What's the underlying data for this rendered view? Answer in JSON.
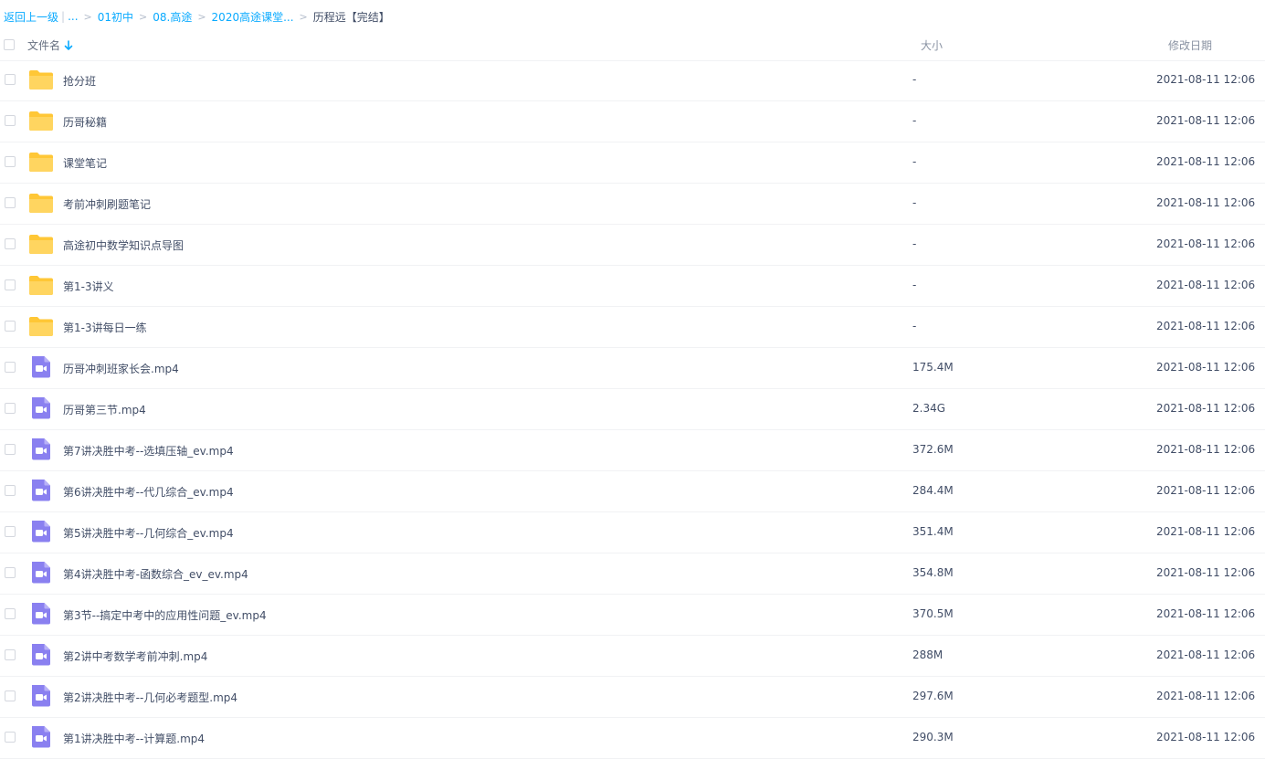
{
  "breadcrumb": {
    "back": "返回上一级",
    "separator": "|",
    "ellipsis": "...",
    "arrow": ">",
    "crumbs": [
      "01初中",
      "08.高途",
      "2020高途课堂..."
    ],
    "current": "历程远【完结】"
  },
  "header": {
    "name": "文件名",
    "size": "大小",
    "date": "修改日期",
    "sort_icon": "arrow-down-icon"
  },
  "colors": {
    "link": "#09aaff",
    "folder": "#ffd04b",
    "video": "#8a80f0",
    "text": "#424e67"
  },
  "files": [
    {
      "type": "folder",
      "name": "抢分班",
      "size": "-",
      "date": "2021-08-11 12:06"
    },
    {
      "type": "folder",
      "name": "历哥秘籍",
      "size": "-",
      "date": "2021-08-11 12:06"
    },
    {
      "type": "folder",
      "name": "课堂笔记",
      "size": "-",
      "date": "2021-08-11 12:06"
    },
    {
      "type": "folder",
      "name": "考前冲刺刷题笔记",
      "size": "-",
      "date": "2021-08-11 12:06"
    },
    {
      "type": "folder",
      "name": "高途初中数学知识点导图",
      "size": "-",
      "date": "2021-08-11 12:06"
    },
    {
      "type": "folder",
      "name": "第1-3讲义",
      "size": "-",
      "date": "2021-08-11 12:06"
    },
    {
      "type": "folder",
      "name": "第1-3讲每日一练",
      "size": "-",
      "date": "2021-08-11 12:06"
    },
    {
      "type": "video",
      "name": "历哥冲刺班家长会.mp4",
      "size": "175.4M",
      "date": "2021-08-11 12:06"
    },
    {
      "type": "video",
      "name": "历哥第三节.mp4",
      "size": "2.34G",
      "date": "2021-08-11 12:06"
    },
    {
      "type": "video",
      "name": "第7讲决胜中考--选填压轴_ev.mp4",
      "size": "372.6M",
      "date": "2021-08-11 12:06"
    },
    {
      "type": "video",
      "name": "第6讲决胜中考--代几综合_ev.mp4",
      "size": "284.4M",
      "date": "2021-08-11 12:06"
    },
    {
      "type": "video",
      "name": "第5讲决胜中考--几何综合_ev.mp4",
      "size": "351.4M",
      "date": "2021-08-11 12:06"
    },
    {
      "type": "video",
      "name": "第4讲决胜中考-函数综合_ev_ev.mp4",
      "size": "354.8M",
      "date": "2021-08-11 12:06"
    },
    {
      "type": "video",
      "name": "第3节--搞定中考中的应用性问题_ev.mp4",
      "size": "370.5M",
      "date": "2021-08-11 12:06"
    },
    {
      "type": "video",
      "name": "第2讲中考数学考前冲刺.mp4",
      "size": "288M",
      "date": "2021-08-11 12:06"
    },
    {
      "type": "video",
      "name": "第2讲决胜中考--几何必考题型.mp4",
      "size": "297.6M",
      "date": "2021-08-11 12:06"
    },
    {
      "type": "video",
      "name": "第1讲决胜中考--计算题.mp4",
      "size": "290.3M",
      "date": "2021-08-11 12:06"
    }
  ]
}
